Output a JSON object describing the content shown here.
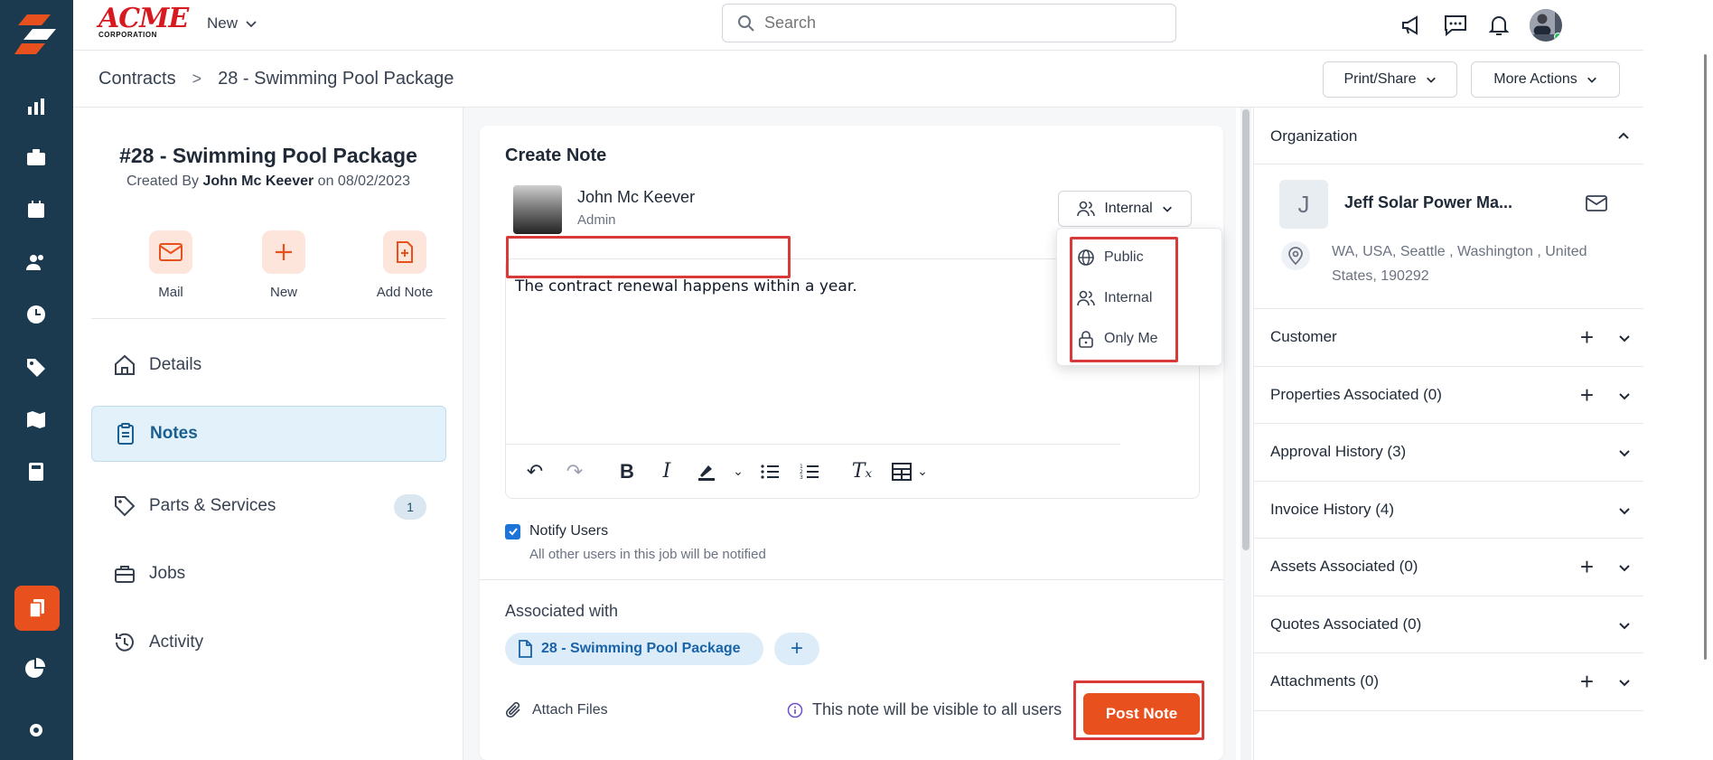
{
  "topbar": {
    "brand_big": "ACME",
    "brand_small": "CORPORATION",
    "new_label": "New",
    "search_placeholder": "Search"
  },
  "breadcrumb": {
    "parent": "Contracts",
    "separator": ">",
    "current": "28 - Swimming Pool Package"
  },
  "actions": {
    "print_share": "Print/Share",
    "more_actions": "More Actions"
  },
  "record": {
    "title": "#28 - Swimming Pool Package",
    "created_prefix": "Created By",
    "created_by": "John Mc Keever",
    "created_on_prefix": "on",
    "created_date": "08/02/2023"
  },
  "quick_actions": [
    {
      "label": "Mail"
    },
    {
      "label": "New"
    },
    {
      "label": "Add Note"
    }
  ],
  "nav": {
    "details": "Details",
    "notes": "Notes",
    "parts_services": "Parts & Services",
    "parts_services_count": "1",
    "jobs": "Jobs",
    "activity": "Activity"
  },
  "note": {
    "title": "Create Note",
    "author_name": "John Mc Keever",
    "author_role": "Admin",
    "visibility": "Internal",
    "body": "The contract renewal happens within a year.",
    "notify_label": "Notify Users",
    "notify_sub": "All other users in this job will be notified",
    "associated_title": "Associated with",
    "associated_chip": "28 - Swimming Pool Package",
    "attach_label": "Attach Files",
    "visibility_note": "This note will be visible to all users",
    "post_label": "Post Note"
  },
  "visibility_options": [
    {
      "label": "Public",
      "icon": "globe-icon"
    },
    {
      "label": "Internal",
      "icon": "users-icon"
    },
    {
      "label": "Only Me",
      "icon": "lock-icon"
    }
  ],
  "organization": {
    "heading": "Organization",
    "avatar_letter": "J",
    "name": "Jeff Solar Power Ma...",
    "address": "WA, USA, Seattle , Washington , United States, 190292"
  },
  "sections": [
    {
      "label": "Customer",
      "add": true
    },
    {
      "label": "Properties Associated (0)",
      "add": true
    },
    {
      "label": "Approval History (3)",
      "add": false
    },
    {
      "label": "Invoice History (4)",
      "add": false
    },
    {
      "label": "Assets Associated (0)",
      "add": true
    },
    {
      "label": "Quotes Associated (0)",
      "add": false
    },
    {
      "label": "Attachments (0)",
      "add": true
    }
  ],
  "colors": {
    "rail": "#1b3a4f",
    "accent": "#e8501e",
    "highlight": "#d83a3a",
    "link": "#1a63a8"
  }
}
